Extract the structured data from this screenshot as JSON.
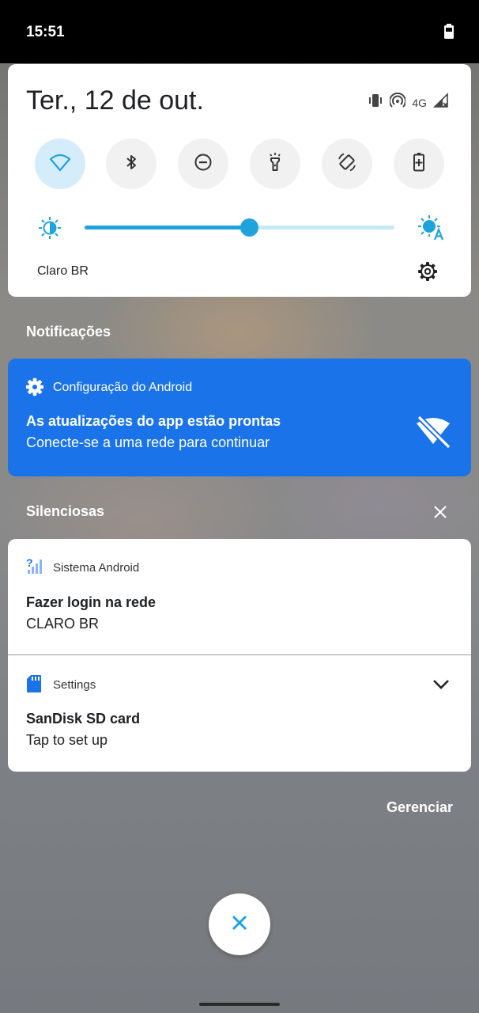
{
  "status_bar": {
    "time": "15:51",
    "battery_icon": "battery-icon"
  },
  "quick_settings": {
    "date": "Ter., 12 de out.",
    "system_icons": [
      "vibrate-icon",
      "hotspot-icon",
      "signal-icon"
    ],
    "network_type": "4G",
    "tiles": [
      {
        "icon": "wifi-icon",
        "active": true
      },
      {
        "icon": "bluetooth-icon",
        "active": false
      },
      {
        "icon": "do-not-disturb-icon",
        "active": false
      },
      {
        "icon": "flashlight-icon",
        "active": false
      },
      {
        "icon": "auto-rotate-icon",
        "active": false
      },
      {
        "icon": "battery-saver-icon",
        "active": false
      }
    ],
    "brightness": {
      "level": 0.53,
      "auto_icon": "auto-brightness-icon"
    },
    "carrier": "Claro BR",
    "settings_icon": "gear-icon"
  },
  "sections": {
    "notifications_title": "Notificações",
    "silent_title": "Silenciosas",
    "manage_label": "Gerenciar"
  },
  "notifications": {
    "alerting": {
      "app": "Configuração do Android",
      "title": "As atualizações do app estão prontas",
      "body": "Conecte-se a uma rede para continuar",
      "icon": "wifi-off-icon"
    },
    "silent": [
      {
        "app": "Sistema Android",
        "title": "Fazer login na rede",
        "body": "CLARO BR",
        "icon": "signal-question-icon"
      },
      {
        "app": "Settings",
        "title": "SanDisk SD card",
        "body": "Tap to set up",
        "icon": "sd-card-icon"
      }
    ]
  },
  "colors": {
    "accent": "#1fa3dc",
    "notification_blue": "#1a73e8",
    "active_tile": "#d5edfa"
  }
}
